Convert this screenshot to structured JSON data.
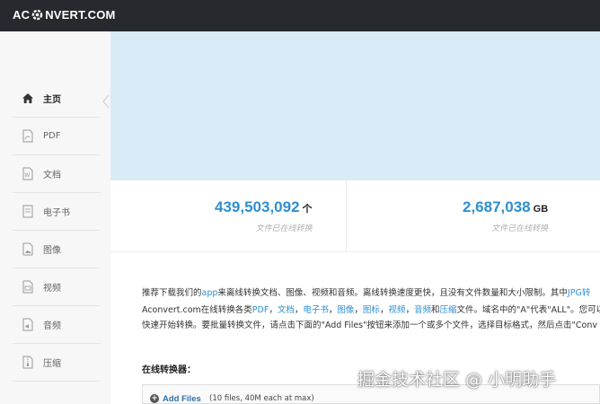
{
  "header": {
    "logo_left": "AC",
    "logo_right": "NVERT.COM",
    "logo_icon": "gear-icon"
  },
  "sidebar": {
    "items": [
      {
        "label": "主页",
        "icon": "home-icon",
        "active": true
      },
      {
        "label": "PDF",
        "icon": "pdf-icon"
      },
      {
        "label": "文档",
        "icon": "word-doc-icon"
      },
      {
        "label": "电子书",
        "icon": "ebook-icon"
      },
      {
        "label": "图像",
        "icon": "image-icon"
      },
      {
        "label": "视频",
        "icon": "video-icon"
      },
      {
        "label": "音频",
        "icon": "audio-icon"
      },
      {
        "label": "压缩",
        "icon": "archive-icon"
      }
    ]
  },
  "stats": [
    {
      "value": "439,503,092",
      "unit": "个",
      "caption": "文件已在线转换"
    },
    {
      "value": "2,687,038",
      "unit": "GB",
      "caption": "文件已在线转换"
    }
  ],
  "content": {
    "line1": {
      "pre": "推荐下载我们的",
      "link1": "app",
      "mid": "来离线转换文档、图像、视频和音频。离线转换速度更快，且没有文件数量和大小限制。其中",
      "link2": "JPG转"
    },
    "line2": {
      "pre": "Aconvert.com在线转换各类",
      "links": [
        "PDF",
        "文档",
        "电子书",
        "图像",
        "图标",
        "视频",
        "音频"
      ],
      "sep": "，",
      "and": "和",
      "link_last": "压缩",
      "post": "文件。域名中的\"A\"代表\"ALL\"。您可以"
    },
    "line3": "快速开始转换。要批量转换文件，请点击下面的\"Add Files\"按钮来添加一个或多个文件，选择目标格式，然后点击\"Conv"
  },
  "converter": {
    "title": "在线转换器：",
    "add_files_label": "Add Files",
    "limit_text": "(10 files, 40M each at max)"
  },
  "watermark": "掘金技术社区 @ 小明助手",
  "colors": {
    "topbar": "#26292e",
    "accent": "#2e8fd0",
    "hero": "#d9ebf7",
    "sidebar": "#f7f7f7"
  }
}
